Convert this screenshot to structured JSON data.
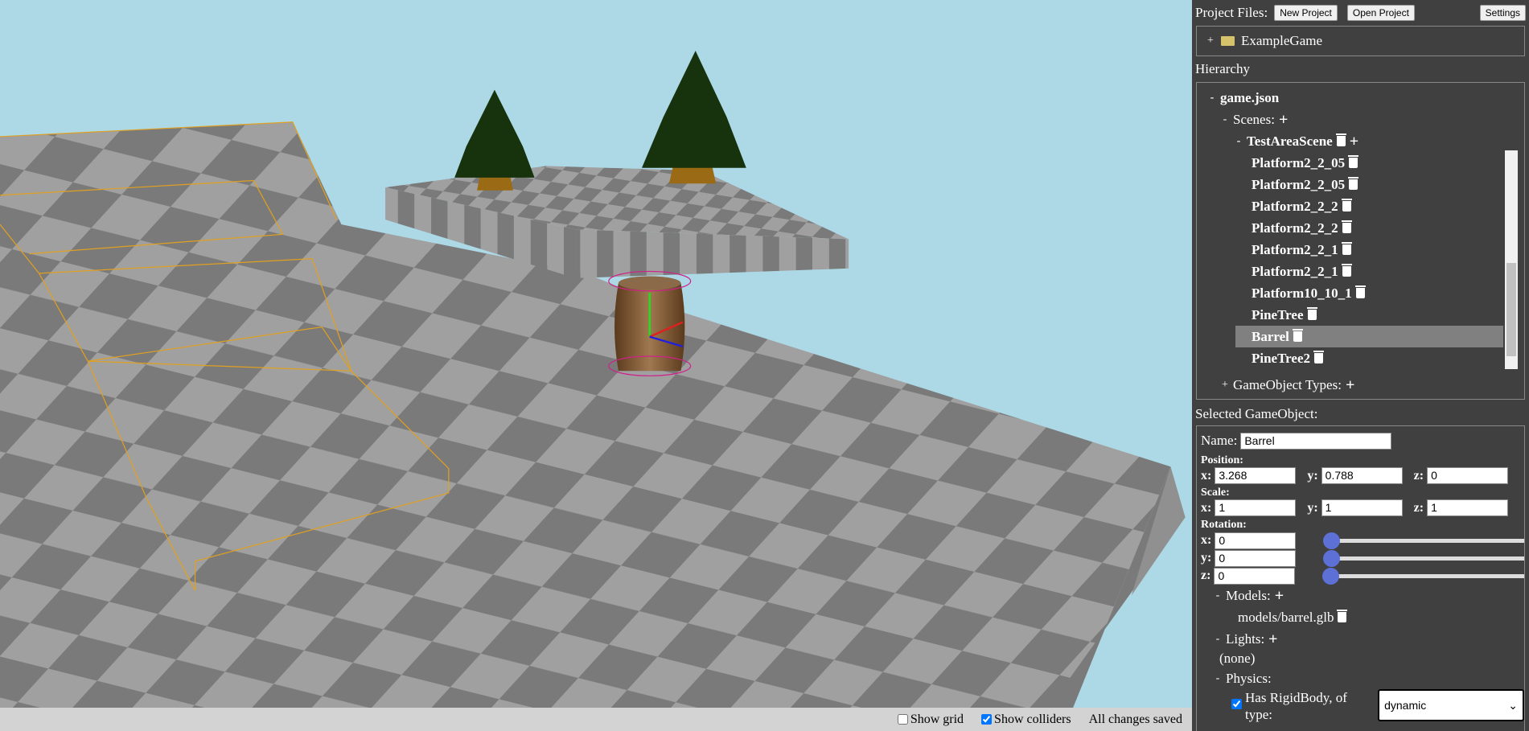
{
  "toolbar": {
    "project_files_label": "Project Files:",
    "new_project": "New Project",
    "open_project": "Open Project",
    "settings": "Settings"
  },
  "files": {
    "items": [
      {
        "toggle": "+",
        "name": "ExampleGame",
        "icon": "folder-icon"
      }
    ]
  },
  "hierarchy": {
    "title": "Hierarchy",
    "root": "game.json",
    "root_toggle": "-",
    "scenes_label": "Scenes:",
    "scenes_toggle": "-",
    "scene": "TestAreaScene",
    "scene_toggle": "-",
    "objects": [
      {
        "name": "Platform2_2_05",
        "selected": false
      },
      {
        "name": "Platform2_2_05",
        "selected": false
      },
      {
        "name": "Platform2_2_2",
        "selected": false
      },
      {
        "name": "Platform2_2_2",
        "selected": false
      },
      {
        "name": "Platform2_2_1",
        "selected": false
      },
      {
        "name": "Platform2_2_1",
        "selected": false
      },
      {
        "name": "Platform10_10_1",
        "selected": false
      },
      {
        "name": "PineTree",
        "selected": false
      },
      {
        "name": "Barrel",
        "selected": true
      },
      {
        "name": "PineTree2",
        "selected": false
      }
    ],
    "types_label": "GameObject Types:",
    "types_toggle": "+"
  },
  "selected": {
    "title": "Selected GameObject:",
    "name_label": "Name:",
    "name": "Barrel",
    "position_label": "Position:",
    "position": {
      "x": "3.268",
      "y": "0.788",
      "z": "0"
    },
    "scale_label": "Scale:",
    "scale": {
      "x": "1",
      "y": "1",
      "z": "1"
    },
    "rotation_label": "Rotation:",
    "rotation": {
      "x": "0",
      "y": "0",
      "z": "0"
    },
    "axis": {
      "x": "x:",
      "y": "y:",
      "z": "z:"
    },
    "models_label": "Models:",
    "models_toggle": "-",
    "models": [
      "models/barrel.glb"
    ],
    "lights_label": "Lights:",
    "lights_toggle": "-",
    "lights_none": "(none)",
    "physics_label": "Physics:",
    "physics_toggle": "-",
    "rigidbody_label": "Has RigidBody, of type:",
    "rigidbody_checked": true,
    "rigidbody_type": "dynamic"
  },
  "status": {
    "show_grid": "Show grid",
    "show_grid_checked": false,
    "show_colliders": "Show colliders",
    "show_colliders_checked": true,
    "save_status": "All changes saved"
  },
  "colors": {
    "sky": "#add8e6",
    "panel": "#404040",
    "accent": "#5c70d6",
    "selection": "#808080",
    "collider": "#d0208a"
  }
}
